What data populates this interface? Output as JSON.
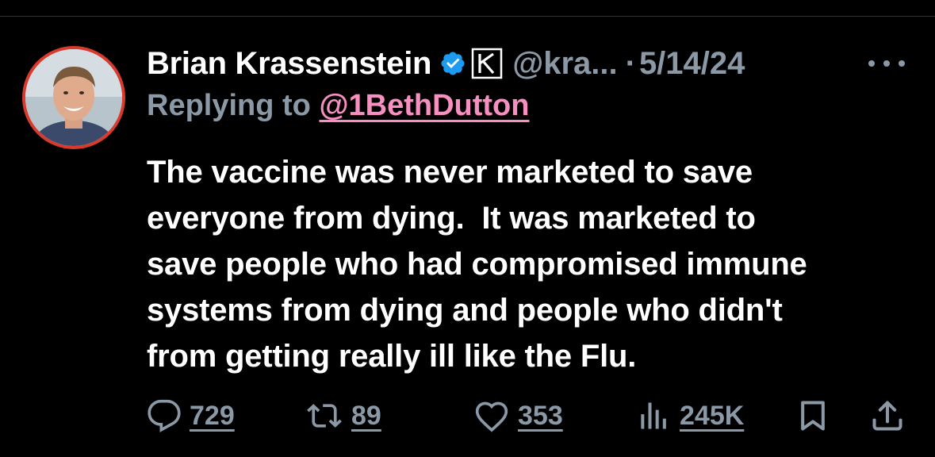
{
  "tweet": {
    "author": {
      "display_name": "Brian Krassenstein",
      "handle": "@kra...",
      "verified": true,
      "affiliate_badge_letter": "K"
    },
    "separator": "·",
    "date": "5/14/24",
    "replying_prefix": "Replying to ",
    "replying_to": "@1BethDutton",
    "text": "The vaccine was never marketed to save\neveryone from dying.  It was marketed to\nsave people who had compromised immune\nsystems from dying and people who didn't\nfrom getting really ill like the Flu.",
    "stats": {
      "replies": "729",
      "reposts": "89",
      "likes": "353",
      "views": "245K"
    }
  },
  "icons": [
    "verified-badge-icon",
    "affiliate-k-icon",
    "more-icon",
    "reply-icon",
    "repost-icon",
    "like-icon",
    "views-icon",
    "bookmark-icon",
    "share-icon"
  ],
  "colors": {
    "background": "#000000",
    "text": "#ffffff",
    "secondary": "#8b98a5",
    "mention": "#f78fc1",
    "verified": "#1d9bf0",
    "avatar_border": "#d93a2b"
  }
}
